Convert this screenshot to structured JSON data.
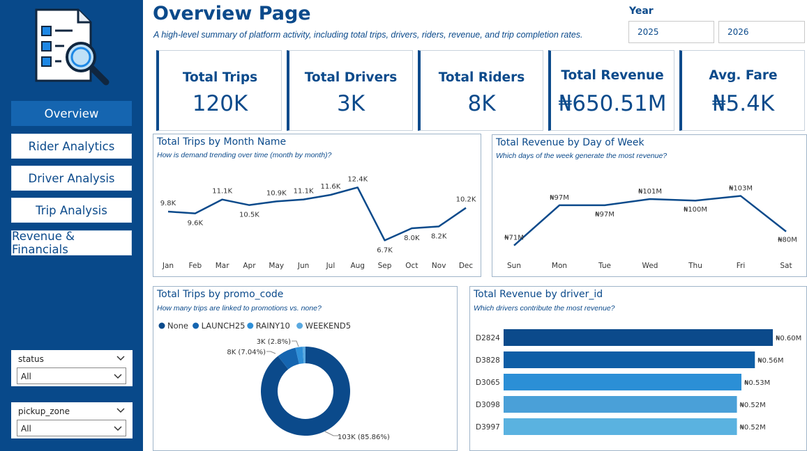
{
  "nav": {
    "items": [
      {
        "label": "Overview",
        "active": true
      },
      {
        "label": "Rider Analytics",
        "active": false
      },
      {
        "label": "Driver Analysis",
        "active": false
      },
      {
        "label": "Trip Analysis",
        "active": false
      },
      {
        "label": "Revenue & Financials",
        "active": false
      }
    ]
  },
  "filters": {
    "status": {
      "label": "status",
      "value": "All"
    },
    "pickup_zone": {
      "label": "pickup_zone",
      "value": "All"
    }
  },
  "header": {
    "title": "Overview Page",
    "subtitle": "A high-level summary of platform activity, including total trips, drivers, riders, revenue, and trip completion rates."
  },
  "year": {
    "label": "Year",
    "options": [
      "2025",
      "2026"
    ]
  },
  "kpis": [
    {
      "label": "Total Trips",
      "value": "120K"
    },
    {
      "label": "Total Drivers",
      "value": "3K"
    },
    {
      "label": "Total Riders",
      "value": "8K"
    },
    {
      "label": "Total Revenue",
      "value": "₦650.51M"
    },
    {
      "label": "Avg. Fare",
      "value": "₦5.4K"
    }
  ],
  "panels": {
    "trips_month": {
      "title": "Total Trips by Month Name",
      "subtitle": "How is demand trending over time (month by month)?"
    },
    "revenue_dow": {
      "title": "Total Revenue by Day of Week",
      "subtitle": "Which days of the week generate the most revenue?"
    },
    "promo": {
      "title": "Total Trips by promo_code",
      "subtitle": "How many trips are linked to promotions vs. none?"
    },
    "driver_rev": {
      "title": "Total Revenue by driver_id",
      "subtitle": "Which drivers contribute the most revenue?"
    }
  },
  "colors": {
    "primary": "#0b4a8b",
    "sidebar": "#08498a",
    "active_nav": "#1565b0",
    "line": "#0b4a8b"
  },
  "chart_data": [
    {
      "type": "line",
      "categories": [
        "Jan",
        "Feb",
        "Mar",
        "Apr",
        "May",
        "Jun",
        "Jul",
        "Aug",
        "Sep",
        "Oct",
        "Nov",
        "Dec"
      ],
      "values": [
        9.8,
        9.6,
        11.1,
        10.5,
        10.9,
        11.1,
        11.6,
        12.4,
        6.7,
        8.0,
        8.2,
        10.2
      ],
      "labels": [
        "9.8K",
        "9.6K",
        "11.1K",
        "10.5K",
        "10.9K",
        "11.1K",
        "11.6K",
        "12.4K",
        "6.7K",
        "8.0K",
        "8.2K",
        "10.2K"
      ],
      "ylim": [
        5,
        14
      ]
    },
    {
      "type": "line",
      "categories": [
        "Sun",
        "Mon",
        "Tue",
        "Wed",
        "Thu",
        "Fri",
        "Sat"
      ],
      "values": [
        71,
        97,
        97,
        101,
        100,
        103,
        80
      ],
      "labels": [
        "₦71M",
        "₦97M",
        "₦97M",
        "₦101M",
        "₦100M",
        "₦103M",
        "₦80M"
      ],
      "ylim": [
        65,
        110
      ]
    },
    {
      "type": "pie",
      "legend": [
        "None",
        "LAUNCH25",
        "RAINY10",
        "WEEKEND5"
      ],
      "values": [
        103,
        8,
        3,
        1.2
      ],
      "percent": [
        85.86,
        7.04,
        2.8,
        1.0
      ],
      "labels": [
        "103K (85.86%)",
        "8K (7.04%)",
        "3K (2.8%)",
        ""
      ],
      "colors": [
        "#0b4a8b",
        "#1565b0",
        "#2e8fd8",
        "#5aa9e0"
      ]
    },
    {
      "type": "bar",
      "orientation": "horizontal",
      "categories": [
        "D2824",
        "D3828",
        "D3065",
        "D3098",
        "D3997"
      ],
      "values": [
        0.6,
        0.56,
        0.53,
        0.52,
        0.52
      ],
      "labels": [
        "₦0.60M",
        "₦0.56M",
        "₦0.53M",
        "₦0.52M",
        "₦0.52M"
      ],
      "xlim": [
        0,
        0.62
      ],
      "colors": [
        "#0b4a8b",
        "#0e5ea6",
        "#2b8fd6",
        "#4aa0d8",
        "#5ab2e0"
      ]
    }
  ]
}
